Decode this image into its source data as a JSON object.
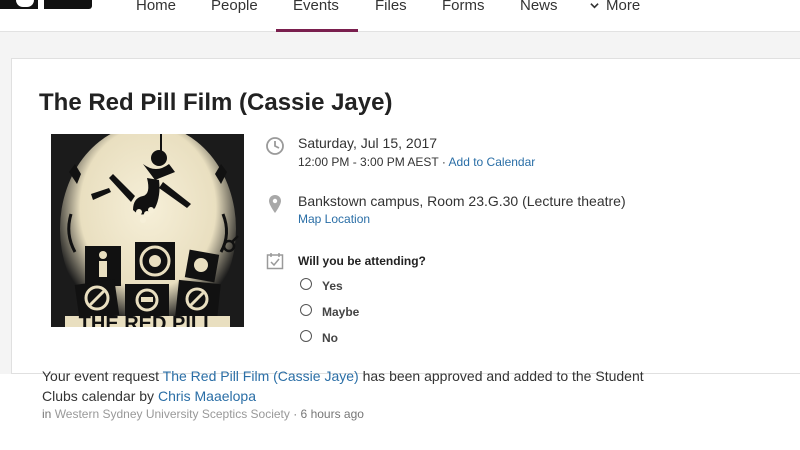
{
  "nav": {
    "items": [
      "Home",
      "People",
      "Events",
      "Files",
      "Forms",
      "News"
    ],
    "active": "Events",
    "more_label": "More",
    "accent_color": "#7a1f4e"
  },
  "event": {
    "title": "The Red Pill Film (Cassie Jaye)",
    "poster_text": "THE RED PILL",
    "date": "Saturday, Jul 15, 2017",
    "time": "12:00 PM - 3:00 PM AEST",
    "separator": " · ",
    "add_to_calendar": "Add to Calendar",
    "location": "Bankstown campus, Room 23.G.30 (Lecture theatre)",
    "map_link": "Map Location",
    "attend_question": "Will you be attending?",
    "options": [
      "Yes",
      "Maybe",
      "No"
    ],
    "link_color": "#2a6ea6"
  },
  "activity": {
    "text_before": "Your event request ",
    "event_link": "The Red Pill Film (Cassie Jaye)",
    "text_middle": " has been approved and added to the Student Clubs calendar by ",
    "user_link": "Chris Maaelopa",
    "in_label": "in ",
    "group_link": "Western Sydney University Sceptics Society",
    "time_ago": " · 6 hours ago"
  },
  "icons": {
    "date": "clock-icon",
    "location": "map-pin-icon",
    "rsvp": "calendar-check-icon",
    "more": "chevron-down-icon"
  }
}
